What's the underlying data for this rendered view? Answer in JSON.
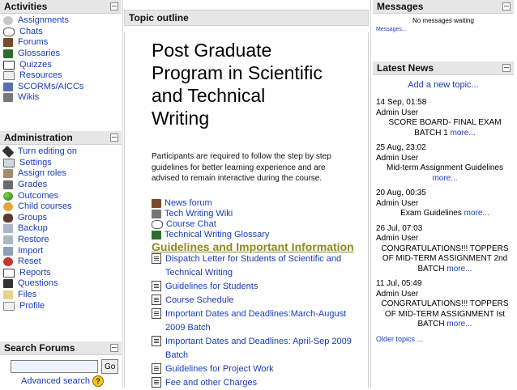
{
  "activities": {
    "title": "Activities",
    "items": [
      {
        "label": "Assignments",
        "icon": "assignment-icon"
      },
      {
        "label": "Chats",
        "icon": "chat-icon"
      },
      {
        "label": "Forums",
        "icon": "forum-icon"
      },
      {
        "label": "Glossaries",
        "icon": "glossary-icon"
      },
      {
        "label": "Quizzes",
        "icon": "quiz-icon"
      },
      {
        "label": "Resources",
        "icon": "resource-icon"
      },
      {
        "label": "SCORMs/AICCs",
        "icon": "scorm-icon"
      },
      {
        "label": "Wikis",
        "icon": "wiki-icon"
      }
    ]
  },
  "administration": {
    "title": "Administration",
    "items": [
      {
        "label": "Turn editing on",
        "icon": "edit-icon"
      },
      {
        "label": "Settings",
        "icon": "settings-icon"
      },
      {
        "label": "Assign roles",
        "icon": "roles-icon"
      },
      {
        "label": "Grades",
        "icon": "grades-icon"
      },
      {
        "label": "Outcomes",
        "icon": "outcomes-icon"
      },
      {
        "label": "Child courses",
        "icon": "child-courses-icon"
      },
      {
        "label": "Groups",
        "icon": "groups-icon"
      },
      {
        "label": "Backup",
        "icon": "backup-icon"
      },
      {
        "label": "Restore",
        "icon": "restore-icon"
      },
      {
        "label": "Import",
        "icon": "import-icon"
      },
      {
        "label": "Reset",
        "icon": "reset-icon"
      },
      {
        "label": "Reports",
        "icon": "reports-icon"
      },
      {
        "label": "Questions",
        "icon": "questions-icon"
      },
      {
        "label": "Files",
        "icon": "files-icon"
      },
      {
        "label": "Profile",
        "icon": "profile-icon"
      }
    ]
  },
  "search": {
    "title": "Search Forums",
    "value": "",
    "go_label": "Go",
    "advanced_label": "Advanced search"
  },
  "topic": {
    "header": "Topic outline",
    "title_line1": "Post Graduate",
    "title_line2": "Program in Scientific",
    "title_line3": "and Technical",
    "title_line4": "Writing",
    "description": "Participants are required to follow the step by step guidelines for better learning experience and are advised to remain interactive during the course.",
    "resources": [
      {
        "label": "News forum",
        "icon": "forum-icon"
      },
      {
        "label": "Tech Writing Wiki",
        "icon": "wiki-icon"
      },
      {
        "label": "Course Chat",
        "icon": "chat-icon"
      },
      {
        "label": "Technical Writing Glossary",
        "icon": "glossary-icon"
      }
    ],
    "section_heading": "Guidelines and Important Information",
    "documents": [
      {
        "label": "Dispatch Letter for Students of Scientific and Technical Writing"
      },
      {
        "label": "Guidelines for Students"
      },
      {
        "label": "Course Schedule"
      },
      {
        "label": "Important Dates and Deadlines:March-August 2009 Batch"
      },
      {
        "label": "Important Dates and Deadlines: April-Sep 2009 Batch"
      },
      {
        "label": "Guidelines for Project Work"
      },
      {
        "label": "Fee and other Charges"
      }
    ]
  },
  "messages": {
    "title": "Messages",
    "empty_text": "No messages waiting",
    "link_label": "Messages..."
  },
  "news": {
    "title": "Latest News",
    "add_label": "Add a new topic...",
    "more_label": "more...",
    "items": [
      {
        "date": "14 Sep, 01:58",
        "author": "Admin User",
        "text": "SCORE BOARD- FINAL EXAM BATCH 1"
      },
      {
        "date": "25 Aug, 23:02",
        "author": "Admin User",
        "text": "Mid-term Assignment Guidelines"
      },
      {
        "date": "20 Aug, 00:35",
        "author": "Admin User",
        "text": "Exam Guidelines"
      },
      {
        "date": "26 Jul, 07:03",
        "author": "Admin User",
        "text": "CONGRATULATIONS!!! TOPPERS OF MID-TERM ASSIGNMENT 2nd BATCH"
      },
      {
        "date": "11 Jul, 05:49",
        "author": "Admin User",
        "text": "CONGRATULATIONS!!! TOPPERS OF MID-TERM ASSIGNMENT Ist BATCH"
      }
    ],
    "older_label": "Older topics ..."
  }
}
